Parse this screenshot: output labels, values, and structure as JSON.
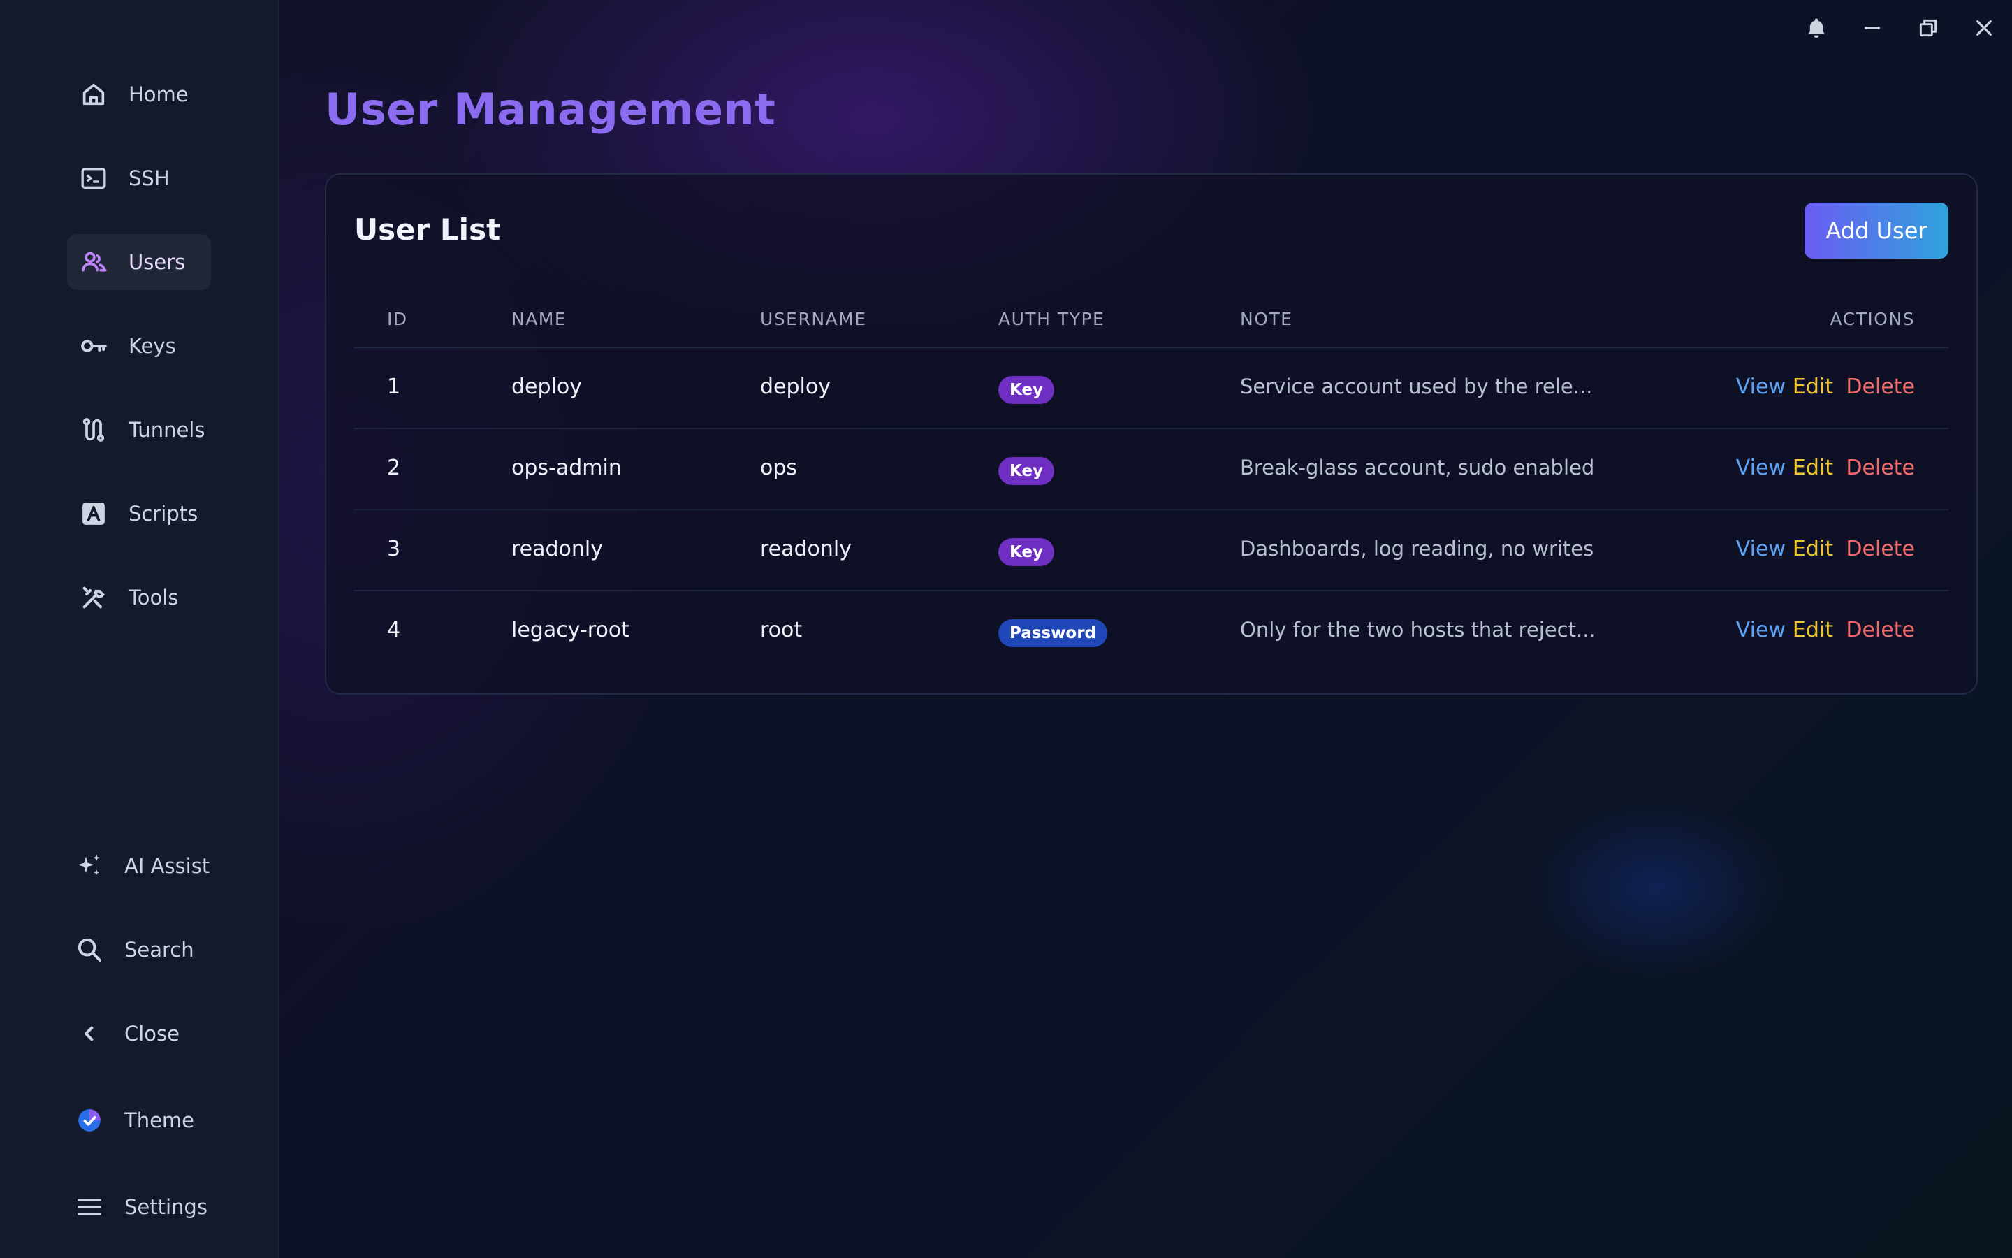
{
  "sidebar": {
    "top_items": [
      {
        "label": "Home",
        "icon": "home-icon"
      },
      {
        "label": "SSH",
        "icon": "terminal-icon"
      },
      {
        "label": "Users",
        "icon": "users-icon",
        "active": true
      },
      {
        "label": "Keys",
        "icon": "key-icon"
      },
      {
        "label": "Tunnels",
        "icon": "tunnel-icon"
      },
      {
        "label": "Scripts",
        "icon": "script-icon"
      },
      {
        "label": "Tools",
        "icon": "tools-icon"
      }
    ],
    "bottom_items": [
      {
        "label": "AI Assist",
        "icon": "sparkle-icon"
      },
      {
        "label": "Search",
        "icon": "search-icon"
      },
      {
        "label": "Close",
        "icon": "chevron-left-icon"
      },
      {
        "label": "Theme",
        "icon": "theme-icon"
      },
      {
        "label": "Settings",
        "icon": "menu-icon"
      }
    ]
  },
  "window_controls": [
    "bell-icon",
    "minimize-icon",
    "restore-icon",
    "close-icon"
  ],
  "page": {
    "title": "User Management"
  },
  "card": {
    "title": "User List",
    "add_button_label": "Add User"
  },
  "table": {
    "headers": {
      "id": "ID",
      "name": "NAME",
      "username": "USERNAME",
      "auth_type": "AUTH TYPE",
      "note": "NOTE",
      "actions": "ACTIONS"
    },
    "rows": [
      {
        "id": "1",
        "name": "deploy",
        "username": "deploy",
        "auth_type": "Key",
        "note": "Service account used by the rele..."
      },
      {
        "id": "2",
        "name": "ops-admin",
        "username": "ops",
        "auth_type": "Key",
        "note": "Break-glass account, sudo enabled"
      },
      {
        "id": "3",
        "name": "readonly",
        "username": "readonly",
        "auth_type": "Key",
        "note": "Dashboards, log reading, no writes"
      },
      {
        "id": "4",
        "name": "legacy-root",
        "username": "root",
        "auth_type": "Password",
        "note": "Only for the two hosts that reject..."
      }
    ],
    "actions": {
      "view": "View",
      "edit": "Edit",
      "delete": "Delete"
    }
  },
  "colors": {
    "accent": "#8b6cf0",
    "view": "#5aa2f5",
    "edit": "#f2c631",
    "delete": "#f26b6b",
    "badge_key": "#6e2fc2",
    "badge_password": "#1f47b8"
  }
}
